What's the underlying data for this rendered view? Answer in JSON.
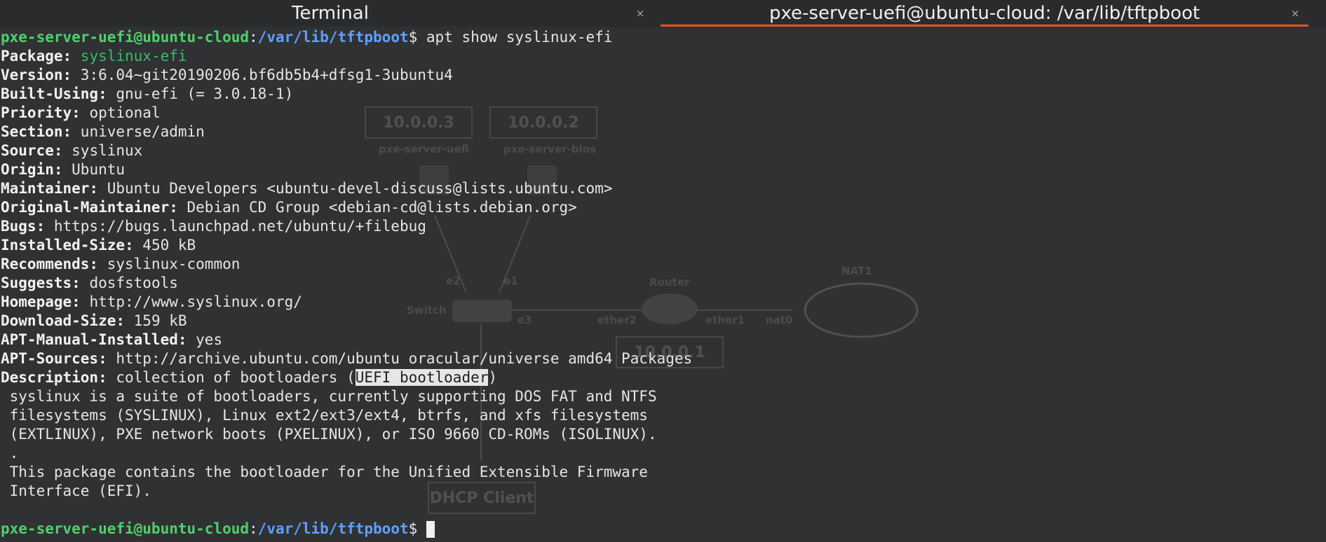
{
  "tabs": [
    {
      "label": "Terminal"
    },
    {
      "label": "pxe-server-uefi@ubuntu-cloud: /var/lib/tftpboot"
    }
  ],
  "tab_close_glyph": "×",
  "background_diagram": {
    "boxes": [
      "10.0.0.3",
      "10.0.0.2",
      "10.0.0.1",
      "DHCP Client"
    ],
    "labels": [
      "pxe-server-uefi",
      "pxe-server-bios",
      "Switch",
      "Router",
      "NAT1",
      "e2",
      "e1",
      "e3",
      "ether2",
      "ether1",
      "nat0"
    ]
  },
  "prompt": {
    "user_host": "pxe-server-uefi@ubuntu-cloud",
    "colon": ":",
    "path": "/var/lib/tftpboot",
    "symbol": "$ "
  },
  "command": "apt show syslinux-efi",
  "fields": [
    {
      "key": "Package:",
      "value": " syslinux-efi"
    },
    {
      "key": "Version:",
      "value": " 3:6.04~git20190206.bf6db5b4+dfsg1-3ubuntu4"
    },
    {
      "key": "Built-Using:",
      "value": " gnu-efi (= 3.0.18-1)"
    },
    {
      "key": "Priority:",
      "value": " optional"
    },
    {
      "key": "Section:",
      "value": " universe/admin"
    },
    {
      "key": "Source:",
      "value": " syslinux"
    },
    {
      "key": "Origin:",
      "value": " Ubuntu"
    },
    {
      "key": "Maintainer:",
      "value": " Ubuntu Developers <ubuntu-devel-discuss@lists.ubuntu.com>"
    },
    {
      "key": "Original-Maintainer:",
      "value": " Debian CD Group <debian-cd@lists.debian.org>"
    },
    {
      "key": "Bugs:",
      "value": " https://bugs.launchpad.net/ubuntu/+filebug"
    },
    {
      "key": "Installed-Size:",
      "value": " 450 kB"
    },
    {
      "key": "Recommends:",
      "value": " syslinux-common"
    },
    {
      "key": "Suggests:",
      "value": " dosfstools"
    },
    {
      "key": "Homepage:",
      "value": " http://www.syslinux.org/"
    },
    {
      "key": "Download-Size:",
      "value": " 159 kB"
    },
    {
      "key": "APT-Manual-Installed:",
      "value": " yes"
    },
    {
      "key": "APT-Sources:",
      "value": " http://archive.ubuntu.com/ubuntu oracular/universe amd64 Packages"
    }
  ],
  "description": {
    "key": "Description:",
    "pre": " collection of bootloaders (",
    "highlight": "UEFI bootloader",
    "post": ")"
  },
  "description_body": [
    " syslinux is a suite of bootloaders, currently supporting DOS FAT and NTFS",
    " filesystems (SYSLINUX), Linux ext2/ext3/ext4, btrfs, and xfs filesystems",
    " (EXTLINUX), PXE network boots (PXELINUX), or ISO 9660 CD-ROMs (ISOLINUX).",
    " .",
    " This package contains the bootloader for the Unified Extensible Firmware",
    " Interface (EFI)."
  ],
  "colors": {
    "prompt_user": "#4fd16b",
    "prompt_path": "#5fa0ff",
    "package_name": "#3fb86a",
    "active_tab_accent": "#e95420"
  }
}
